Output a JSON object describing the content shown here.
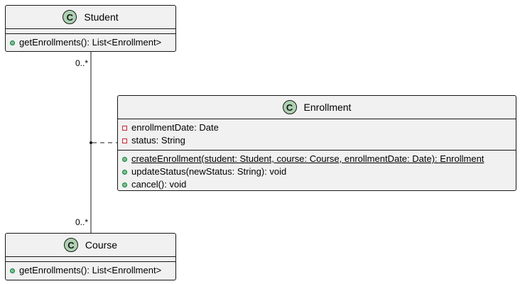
{
  "classes": {
    "student": {
      "name": "Student",
      "stereotype_glyph": "C",
      "methods": [
        "getEnrollments(): List<Enrollment>"
      ]
    },
    "enrollment": {
      "name": "Enrollment",
      "stereotype_glyph": "C",
      "attributes": [
        "enrollmentDate: Date",
        "status: String"
      ],
      "methods": [
        "createEnrollment(student: Student, course: Course, enrollmentDate: Date): Enrollment",
        "updateStatus(newStatus: String): void",
        "cancel(): void"
      ]
    },
    "course": {
      "name": "Course",
      "stereotype_glyph": "C",
      "methods": [
        "getEnrollments(): List<Enrollment>"
      ]
    }
  },
  "association": {
    "student_multiplicity": "0..*",
    "course_multiplicity": "0..*"
  },
  "colors": {
    "class_fill": "#f1f1f1",
    "class_icon": "#add1b2",
    "public_marker": "#84be84",
    "private_marker": "#c82930",
    "line": "#181818"
  }
}
